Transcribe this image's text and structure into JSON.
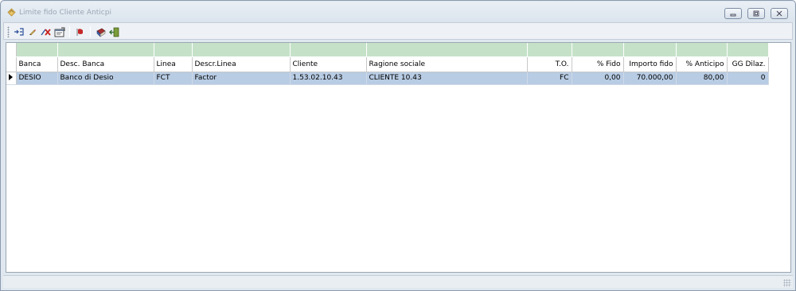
{
  "window": {
    "title": "Limite fido Cliente Anticpi"
  },
  "toolbar": {
    "buttons": [
      {
        "icon": "insert-icon"
      },
      {
        "icon": "edit-icon"
      },
      {
        "icon": "delete-icon"
      },
      {
        "icon": "properties-icon"
      },
      {
        "icon": "flag-icon"
      },
      {
        "icon": "book-icon"
      },
      {
        "icon": "exit-icon"
      }
    ]
  },
  "grid": {
    "columns": [
      "Banca",
      "Desc. Banca",
      "Linea",
      "Descr.Linea",
      "Cliente",
      "Ragione sociale",
      "T.O.",
      "% Fido",
      "Importo fido",
      "% Anticipo",
      "GG Dilaz."
    ],
    "rows": [
      [
        "DESIO",
        "Banco di Desio",
        "FCT",
        "Factor",
        "1.53.02.10.43",
        "CLIENTE 10.43",
        "FC",
        "0,00",
        "70.000,00",
        "80,00",
        "0"
      ]
    ]
  },
  "colors": {
    "header_band": "#c5e2c8",
    "selected_row": "#b8cce4",
    "frame": "#dfe7ef"
  }
}
